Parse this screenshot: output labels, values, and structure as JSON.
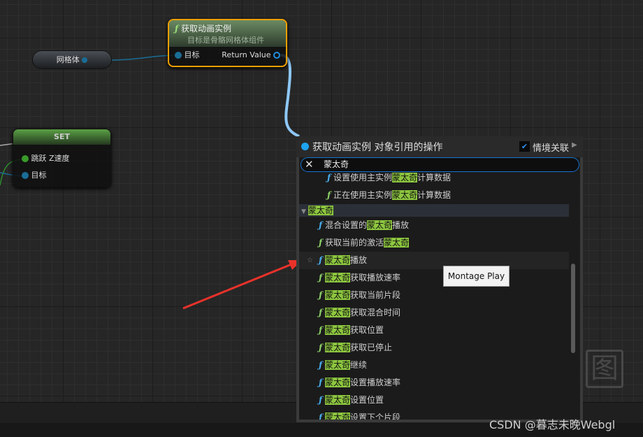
{
  "graph": {
    "mesh_node": {
      "label": "网格体"
    },
    "anim_node": {
      "title": "获取动画实例",
      "subtitle": "目标是骨骼网格体组件",
      "input": "目标",
      "output": "Return Value"
    },
    "set_node": {
      "title": "SET",
      "pin1": "跳跃 Z速度",
      "pin2": "目标"
    }
  },
  "menu": {
    "title": "获取动画实例 对象引用的操作",
    "context_label": "情境关联",
    "context_checked": true,
    "search_value": "蒙太奇",
    "items": [
      {
        "pre": "设置使用主实例",
        "hl": "蒙太奇",
        "post": "计算数据",
        "icon": "blue"
      },
      {
        "pre": "正在使用主实例",
        "hl": "蒙太奇",
        "post": "计算数据",
        "icon": "green"
      },
      {
        "pre": "混合设置的",
        "hl": "蒙太奇",
        "post": "播放",
        "icon": "blue"
      },
      {
        "pre": "获取当前的激活",
        "hl": "蒙太奇",
        "post": "",
        "icon": "green"
      },
      {
        "pre": "",
        "hl": "蒙太奇",
        "post": "播放",
        "icon": "blue"
      },
      {
        "pre": "",
        "hl": "蒙太奇",
        "post": "获取播放速率",
        "icon": "green"
      },
      {
        "pre": "",
        "hl": "蒙太奇",
        "post": "获取当前片段",
        "icon": "green"
      },
      {
        "pre": "",
        "hl": "蒙太奇",
        "post": "获取混合时间",
        "icon": "green"
      },
      {
        "pre": "",
        "hl": "蒙太奇",
        "post": "获取位置",
        "icon": "green"
      },
      {
        "pre": "",
        "hl": "蒙太奇",
        "post": "获取已停止",
        "icon": "green"
      },
      {
        "pre": "",
        "hl": "蒙太奇",
        "post": "继续",
        "icon": "blue"
      },
      {
        "pre": "",
        "hl": "蒙太奇",
        "post": "设置播放速率",
        "icon": "blue"
      },
      {
        "pre": "",
        "hl": "蒙太奇",
        "post": "设置位置",
        "icon": "blue"
      },
      {
        "pre": "",
        "hl": "蒙太奇",
        "post": "设置下个片段",
        "icon": "blue"
      }
    ],
    "category": "蒙太奇",
    "tooltip": "Montage Play",
    "function_glyph": "ƒ"
  },
  "colors": {
    "accent": "#1673d0",
    "highlight": "#8dc63f",
    "selected_border": "#f2a000",
    "fn_blue": "#4ab0f0",
    "fn_green": "#8fd46a"
  },
  "watermark": {
    "text": "CSDN @暮志未晚Webgl",
    "logo": "图"
  }
}
